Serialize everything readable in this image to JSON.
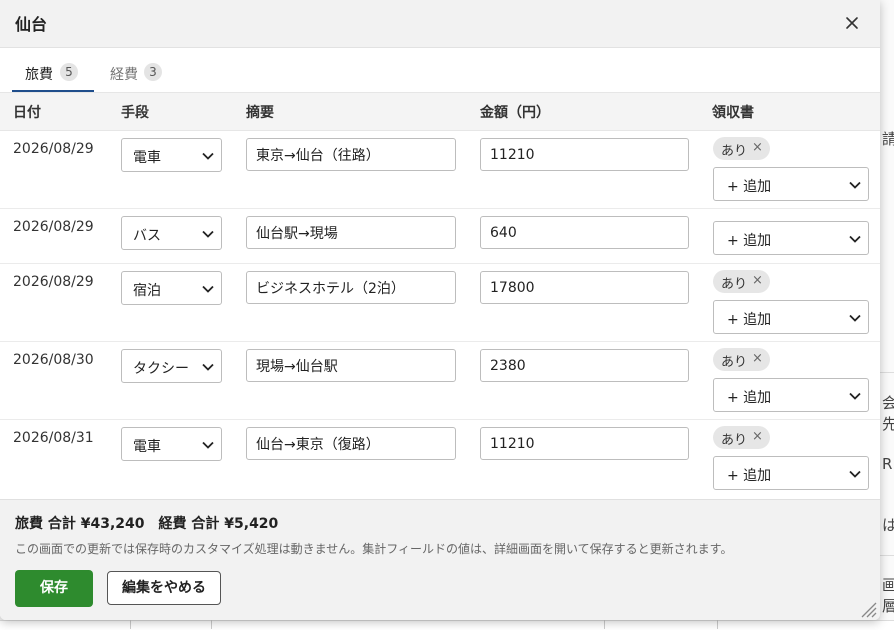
{
  "dialog": {
    "title": "仙台"
  },
  "tabs": [
    {
      "label": "旅費",
      "count": "5"
    },
    {
      "label": "経費",
      "count": "3"
    }
  ],
  "columns": {
    "date": "日付",
    "method": "手段",
    "summary": "摘要",
    "amount": "金額（円）",
    "receipt": "領収書"
  },
  "rows": [
    {
      "date": "2026/08/29",
      "method": "電車",
      "summary": "東京→仙台（往路）",
      "amount": "11210",
      "receipt_chip": "あり",
      "add_label": "+ 追加"
    },
    {
      "date": "2026/08/29",
      "method": "バス",
      "summary": "仙台駅→現場",
      "amount": "640",
      "receipt_chip": "",
      "add_label": "+ 追加"
    },
    {
      "date": "2026/08/29",
      "method": "宿泊",
      "summary": "ビジネスホテル（2泊）",
      "amount": "17800",
      "receipt_chip": "あり",
      "add_label": "+ 追加"
    },
    {
      "date": "2026/08/30",
      "method": "タクシー",
      "summary": "現場→仙台駅",
      "amount": "2380",
      "receipt_chip": "あり",
      "add_label": "+ 追加"
    },
    {
      "date": "2026/08/31",
      "method": "電車",
      "summary": "仙台→東京（復路）",
      "amount": "11210",
      "receipt_chip": "あり",
      "add_label": "+ 追加"
    }
  ],
  "footer": {
    "travel_total": "旅費 合計 ¥43,240",
    "expense_total": "経費 合計 ¥5,420",
    "note": "この画面での更新では保存時のカスタマイズ処理は動きません。集計フィールドの値は、詳細画面を開いて保存すると更新されます。",
    "save_label": "保存",
    "cancel_label": "編集をやめる"
  },
  "background_fragments": [
    "請",
    "会先",
    "R",
    "は",
    "画層"
  ],
  "colors": {
    "save": "#2e8b2e",
    "tab_underline": "#1f4e8c"
  },
  "icons": {
    "close": "close-icon",
    "chevron": "chevron-down-icon",
    "chip_remove": "remove-icon",
    "resize": "resize-grip-icon"
  }
}
